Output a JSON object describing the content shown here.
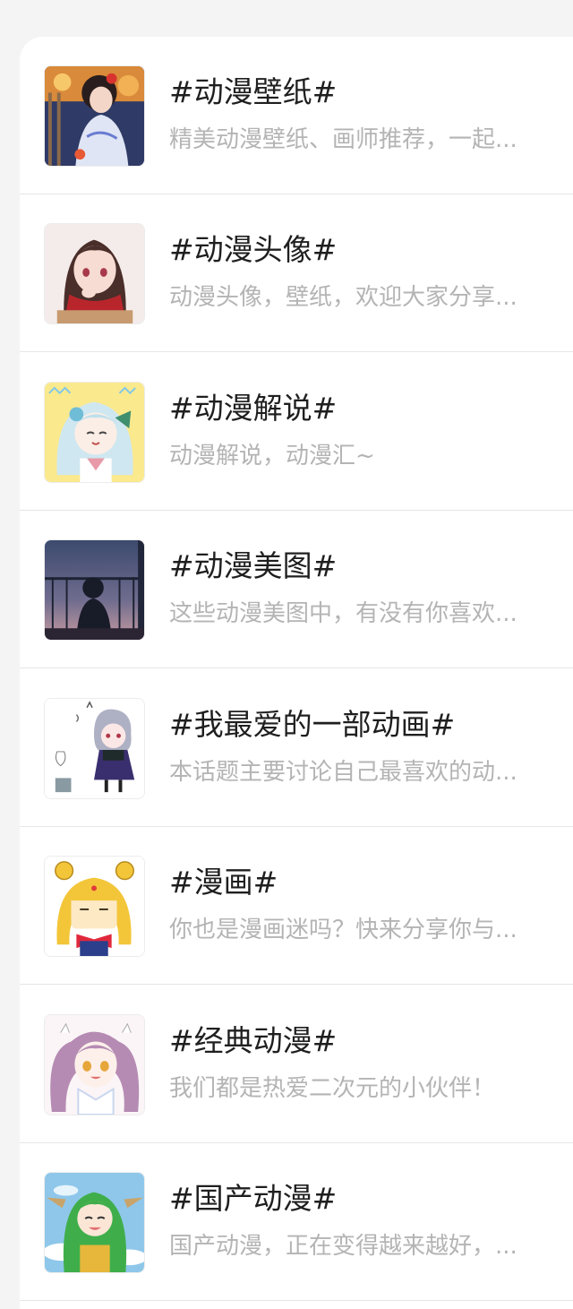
{
  "topics": [
    {
      "title": "#动漫壁纸#",
      "desc": "精美动漫壁纸、画师推荐，一起...",
      "thumb_icon": "anime-girl-night-festival-thumbnail"
    },
    {
      "title": "#动漫头像#",
      "desc": "动漫头像，壁纸，欢迎大家分享...",
      "thumb_icon": "anime-girl-red-scarf-thumbnail"
    },
    {
      "title": "#动漫解说#",
      "desc": "动漫解说，动漫汇~",
      "thumb_icon": "chibi-light-blue-hair-thumbnail"
    },
    {
      "title": "#动漫美图#",
      "desc": "这些动漫美图中，有没有你喜欢...",
      "thumb_icon": "silhouette-balcony-dusk-thumbnail"
    },
    {
      "title": "#我最爱的一部动画#",
      "desc": "本话题主要讨论自己最喜欢的动...",
      "thumb_icon": "chibi-grey-hair-girl-thumbnail"
    },
    {
      "title": "#漫画#",
      "desc": "你也是漫画迷吗？快来分享你与...",
      "thumb_icon": "sailor-moon-chibi-thumbnail"
    },
    {
      "title": "#经典动漫#",
      "desc": "我们都是热爱二次元的小伙伴！",
      "thumb_icon": "anime-girl-purple-twintails-thumbnail"
    },
    {
      "title": "#国产动漫#",
      "desc": "国产动漫，正在变得越来越好，...",
      "thumb_icon": "chibi-green-hair-sky-thumbnail"
    }
  ]
}
